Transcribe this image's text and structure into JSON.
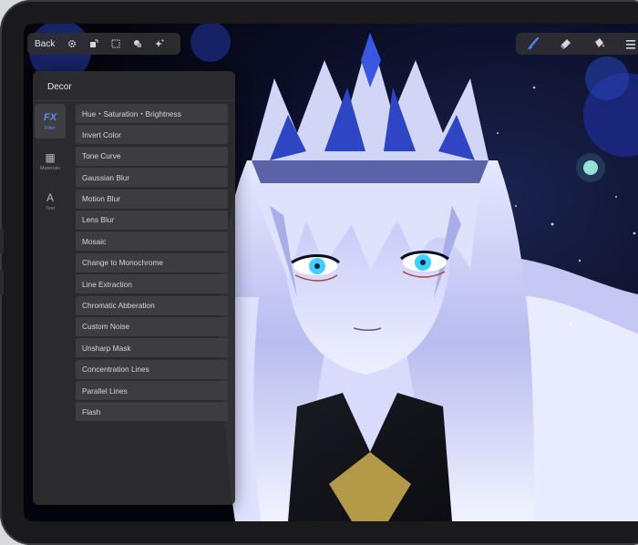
{
  "toolbar": {
    "back_label": "Back",
    "left_icons": [
      "gear-icon",
      "transform-icon",
      "selection-icon",
      "layer-shapes-icon",
      "sparkle-icon"
    ],
    "right_icons": [
      "brush-icon",
      "eraser-icon",
      "fill-bucket-icon",
      "more-icon"
    ]
  },
  "panel": {
    "title": "Decor",
    "tabs": [
      {
        "glyph": "FX",
        "label": "Filter",
        "active": true
      },
      {
        "glyph": "▦",
        "label": "Materials",
        "active": false
      },
      {
        "glyph": "A",
        "label": "Text",
        "active": false
      }
    ],
    "filters": [
      "Hue・Saturation・Brightness",
      "Invert Color",
      "Tone Curve",
      "Gaussian Blur",
      "Motion Blur",
      "Lens Blur",
      "Mosaic",
      "Change to Monochrome",
      "Line Extraction",
      "Chromatic Abberation",
      "Custom Noise",
      "Unsharp Mask",
      "Concentration Lines",
      "Parallel Lines",
      "Flash"
    ]
  },
  "colors": {
    "accent": "#5a8cff",
    "panel_bg": "#2c2c30",
    "item_bg": "#3d3d41"
  }
}
